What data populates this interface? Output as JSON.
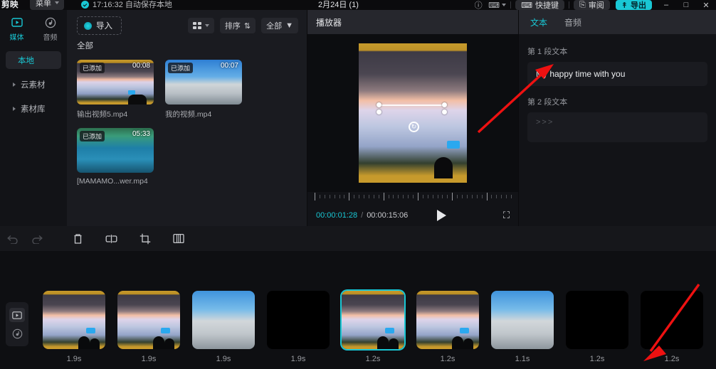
{
  "titlebar": {
    "logo": "剪映",
    "menu_label": "菜单",
    "autosave": "17:16:32 自动保存本地",
    "project_name": "2月24日 (1)",
    "help_icon": "help-icon",
    "keyboard_icon": "keyboard-icon",
    "shortcut_btn": "快捷键",
    "review_btn": "审阅",
    "export_btn": "导出",
    "minimize": "–",
    "maximize": "□",
    "close": "✕"
  },
  "rail": {
    "tabs": [
      {
        "label": "媒体",
        "icon": "media-play-icon",
        "active": true
      },
      {
        "label": "音频",
        "icon": "music-note-icon",
        "active": false
      }
    ],
    "items": [
      {
        "label": "本地",
        "selected": true
      },
      {
        "label": "云素材",
        "selected": false
      },
      {
        "label": "素材库",
        "selected": false
      }
    ]
  },
  "media": {
    "import_label": "导入",
    "view_icon": "grid-view-icon",
    "sort_label": "排序",
    "filter_label": "全部",
    "section_label": "全部",
    "items": [
      {
        "badge": "已添加",
        "duration": "00:08",
        "name": "输出视频5.mp4",
        "thumb": "th1"
      },
      {
        "badge": "已添加",
        "duration": "00:07",
        "name": "我的视频.mp4",
        "thumb": "th2"
      },
      {
        "badge": "已添加",
        "duration": "05:33",
        "name": "[MAMAMO...wer.mp4",
        "thumb": "th3"
      }
    ]
  },
  "player": {
    "title": "播放器",
    "current_time": "00:00:01:28",
    "separator": "/",
    "total_time": "00:00:15:06",
    "play_icon": "play-icon",
    "fullscreen_icon": "fullscreen-icon",
    "rotate_icon": "rotate-handle-icon"
  },
  "right_panel": {
    "tabs": [
      {
        "label": "文本",
        "active": true
      },
      {
        "label": "音频",
        "active": false
      }
    ],
    "fields": [
      {
        "label": "第 1 段文本",
        "value": "My happy time with you",
        "placeholder": ""
      },
      {
        "label": "第 2 段文本",
        "value": "",
        "placeholder": ">>>"
      }
    ]
  },
  "toolbar": {
    "buttons": [
      {
        "name": "undo-icon",
        "label": "↶",
        "enabled": false
      },
      {
        "name": "redo-icon",
        "label": "↷",
        "enabled": false
      },
      {
        "name": "delete-icon",
        "label": "Ὕ1",
        "enabled": true
      },
      {
        "name": "split-icon",
        "label": "",
        "enabled": true
      },
      {
        "name": "crop-icon",
        "label": "",
        "enabled": true
      },
      {
        "name": "mirror-icon",
        "label": "",
        "enabled": true
      }
    ]
  },
  "timeline": {
    "track_video_icon": "video-track-icon",
    "track_audio_icon": "audio-track-icon",
    "clips": [
      {
        "duration": "1.9s",
        "thumb": "ci-fire",
        "selected": false
      },
      {
        "duration": "1.9s",
        "thumb": "ci-fire",
        "selected": false
      },
      {
        "duration": "1.9s",
        "thumb": "ci-sky",
        "selected": false
      },
      {
        "duration": "1.9s",
        "thumb": "ci-black",
        "selected": false
      },
      {
        "duration": "1.2s",
        "thumb": "ci-fire",
        "selected": true
      },
      {
        "duration": "1.2s",
        "thumb": "ci-fire",
        "selected": false
      },
      {
        "duration": "1.1s",
        "thumb": "ci-sky",
        "selected": false
      },
      {
        "duration": "1.2s",
        "thumb": "ci-black",
        "selected": false
      },
      {
        "duration": "1.2s",
        "thumb": "ci-black",
        "selected": false
      }
    ]
  },
  "colors": {
    "accent": "#19c7d4",
    "annotation": "#ee1111",
    "panel_bg": "#121317",
    "app_bg": "#0b0b0d"
  }
}
